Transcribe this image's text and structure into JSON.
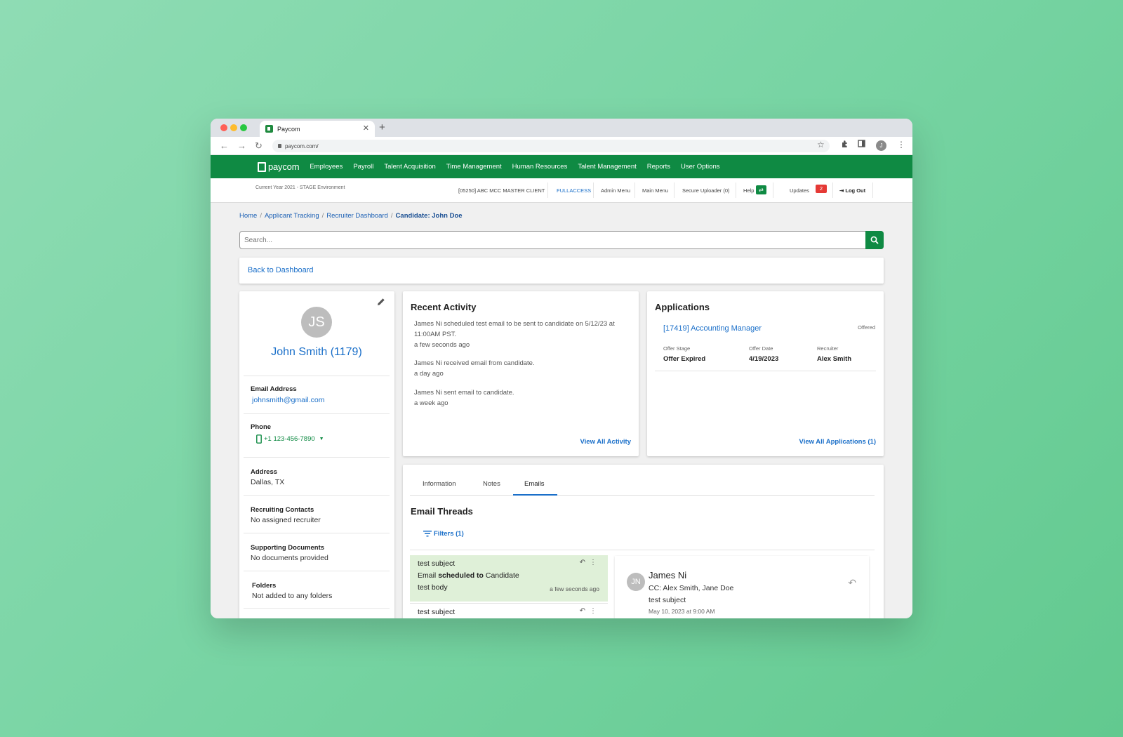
{
  "browser": {
    "tab_title": "Paycom",
    "url": "paycom.com/",
    "profile_initial": "J"
  },
  "nav": {
    "logo": "paycom",
    "items": [
      "Employees",
      "Payroll",
      "Talent Acquisition",
      "Time Management",
      "Human Resources",
      "Talent Management",
      "Reports",
      "User Options"
    ]
  },
  "subbar": {
    "env": "Current Year 2021 - STAGE Environment",
    "client": "[05250] ABC MCC MASTER CLIENT",
    "fullaccess": "FULLACCESS",
    "admin_menu": "Admin Menu",
    "main_menu": "Main Menu",
    "secure_uploader": "Secure Uploader (0)",
    "help": "Help",
    "updates": "Updates",
    "updates_count": "2",
    "logout": "Log Out"
  },
  "breadcrumb": [
    "Home",
    "Applicant Tracking",
    "Recruiter Dashboard",
    "Candidate: John Doe"
  ],
  "search": {
    "placeholder": "Search..."
  },
  "back_link": "Back to Dashboard",
  "profile": {
    "initials": "JS",
    "name": "John Smith (1179)",
    "email_label": "Email Address",
    "email": "johnsmith@gmail.com",
    "phone_label": "Phone",
    "phone": "+1 123-456-7890",
    "address_label": "Address",
    "address": "Dallas, TX",
    "contacts_label": "Recruiting Contacts",
    "contacts": "No assigned recruiter",
    "docs_label": "Supporting Documents",
    "docs": "No documents provided",
    "folders_label": "Folders",
    "folders": "Not added to any folders"
  },
  "recent_activity": {
    "title": "Recent Activity",
    "items": [
      {
        "text": "James Ni scheduled test email to be sent to candidate on 5/12/23 at 11:00AM PST.",
        "time": "a few seconds ago"
      },
      {
        "text": "James Ni received email from candidate.",
        "time": "a day ago"
      },
      {
        "text": "James Ni sent email to candidate.",
        "time": "a week ago"
      }
    ],
    "view_all": "View All Activity"
  },
  "applications": {
    "title": "Applications",
    "job": "[17419] Accounting Manager",
    "status": "Offered",
    "stage_label": "Offer Stage",
    "stage": "Offer Expired",
    "date_label": "Offer Date",
    "date": "4/19/2023",
    "recruiter_label": "Recruiter",
    "recruiter": "Alex Smith",
    "view_all": "View All Applications (1)"
  },
  "tabs": [
    "Information",
    "Notes",
    "Emails"
  ],
  "emails": {
    "title": "Email Threads",
    "filters": "Filters (1)",
    "thread1": {
      "subject": "test subject",
      "line_pre": "Email ",
      "line_bold": "scheduled to",
      "line_post": " Candidate",
      "body": "test body",
      "time": "a few seconds ago"
    },
    "thread2": {
      "subject": "test subject"
    },
    "detail": {
      "initials": "JN",
      "from": "James Ni",
      "cc": "CC: Alex Smith, Jane Doe",
      "subject": "test subject",
      "date": "May 10, 2023 at 9:00 AM"
    }
  }
}
